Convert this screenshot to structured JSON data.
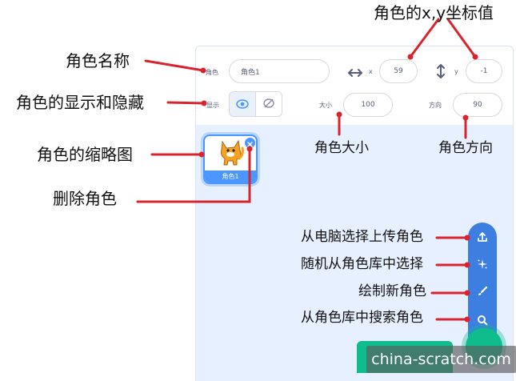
{
  "panel": {
    "name_label": "角色",
    "name_value": "角色1",
    "x_label": "x",
    "x_value": "59",
    "y_label": "y",
    "y_value": "-1",
    "show_label": "显示",
    "size_label": "大小",
    "size_value": "100",
    "direction_label": "方向",
    "direction_value": "90"
  },
  "thumbnail": {
    "label": "角色1"
  },
  "annotations": {
    "xy": "角色的x,y坐标值",
    "name": "角色名称",
    "show_hide": "角色的显示和隐藏",
    "size": "角色大小",
    "direction": "角色方向",
    "thumb": "角色的缩略图",
    "delete": "删除角色",
    "upload": "从电脑选择上传角色",
    "random": "随机从角色库中选择",
    "paint": "绘制新角色",
    "search": "从角色库中搜索角色"
  },
  "icons": {
    "x_arrow": "horizontal-arrow-icon",
    "y_arrow": "vertical-arrow-icon",
    "show": "eye-icon",
    "hide": "eye-slash-icon",
    "delete": "close-icon",
    "upload": "upload-icon",
    "random": "sparkle-icon",
    "paint": "brush-icon",
    "search": "search-icon"
  },
  "colors": {
    "scratch_blue": "#4c97ff",
    "fab_blue": "#3d7fe0",
    "fab_green": "#0fbd8c",
    "annotation_red": "#d9232e",
    "pane_bg": "#e6f0ff"
  },
  "watermark": "china-scratch.com"
}
